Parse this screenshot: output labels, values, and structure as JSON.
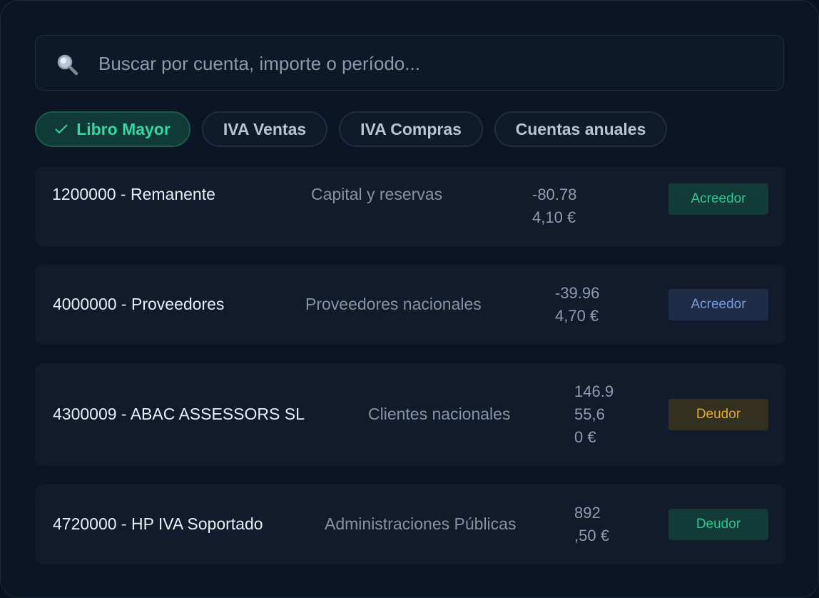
{
  "search": {
    "placeholder": "Buscar por cuenta, importe o período...",
    "icon": "search-icon"
  },
  "filters": [
    {
      "label": "Libro Mayor",
      "active": true
    },
    {
      "label": "IVA Ventas",
      "active": false
    },
    {
      "label": "IVA Compras",
      "active": false
    },
    {
      "label": "Cuentas anuales",
      "active": false
    }
  ],
  "accounts": [
    {
      "account": "1200000 - Remanente",
      "group": "Capital y reservas",
      "amount_lines": [
        "-80.78",
        "4,10 €"
      ],
      "status": "Acreedor",
      "status_color": "#32c793"
    },
    {
      "account": "4000000 - Proveedores",
      "group": "Proveedores nacionales",
      "amount_lines": [
        "-39.96",
        "4,70 €"
      ],
      "status": "Acreedor",
      "status_color": "#7b9bdb"
    },
    {
      "account": "4300009 - ABAC ASSESSORS SL",
      "group": "Clientes nacionales",
      "amount_lines": [
        "146.9",
        "55,6",
        "0 €"
      ],
      "status": "Deudor",
      "status_color": "#e2ac3a"
    },
    {
      "account": "4720000 - HP IVA Soportado",
      "group": "Administraciones Públicas",
      "amount_lines": [
        "892",
        ",50 €"
      ],
      "status": "Deudor",
      "status_color": "#32c793"
    }
  ],
  "colors": {
    "accent": "#35d6a1",
    "background": "#0b1526"
  }
}
